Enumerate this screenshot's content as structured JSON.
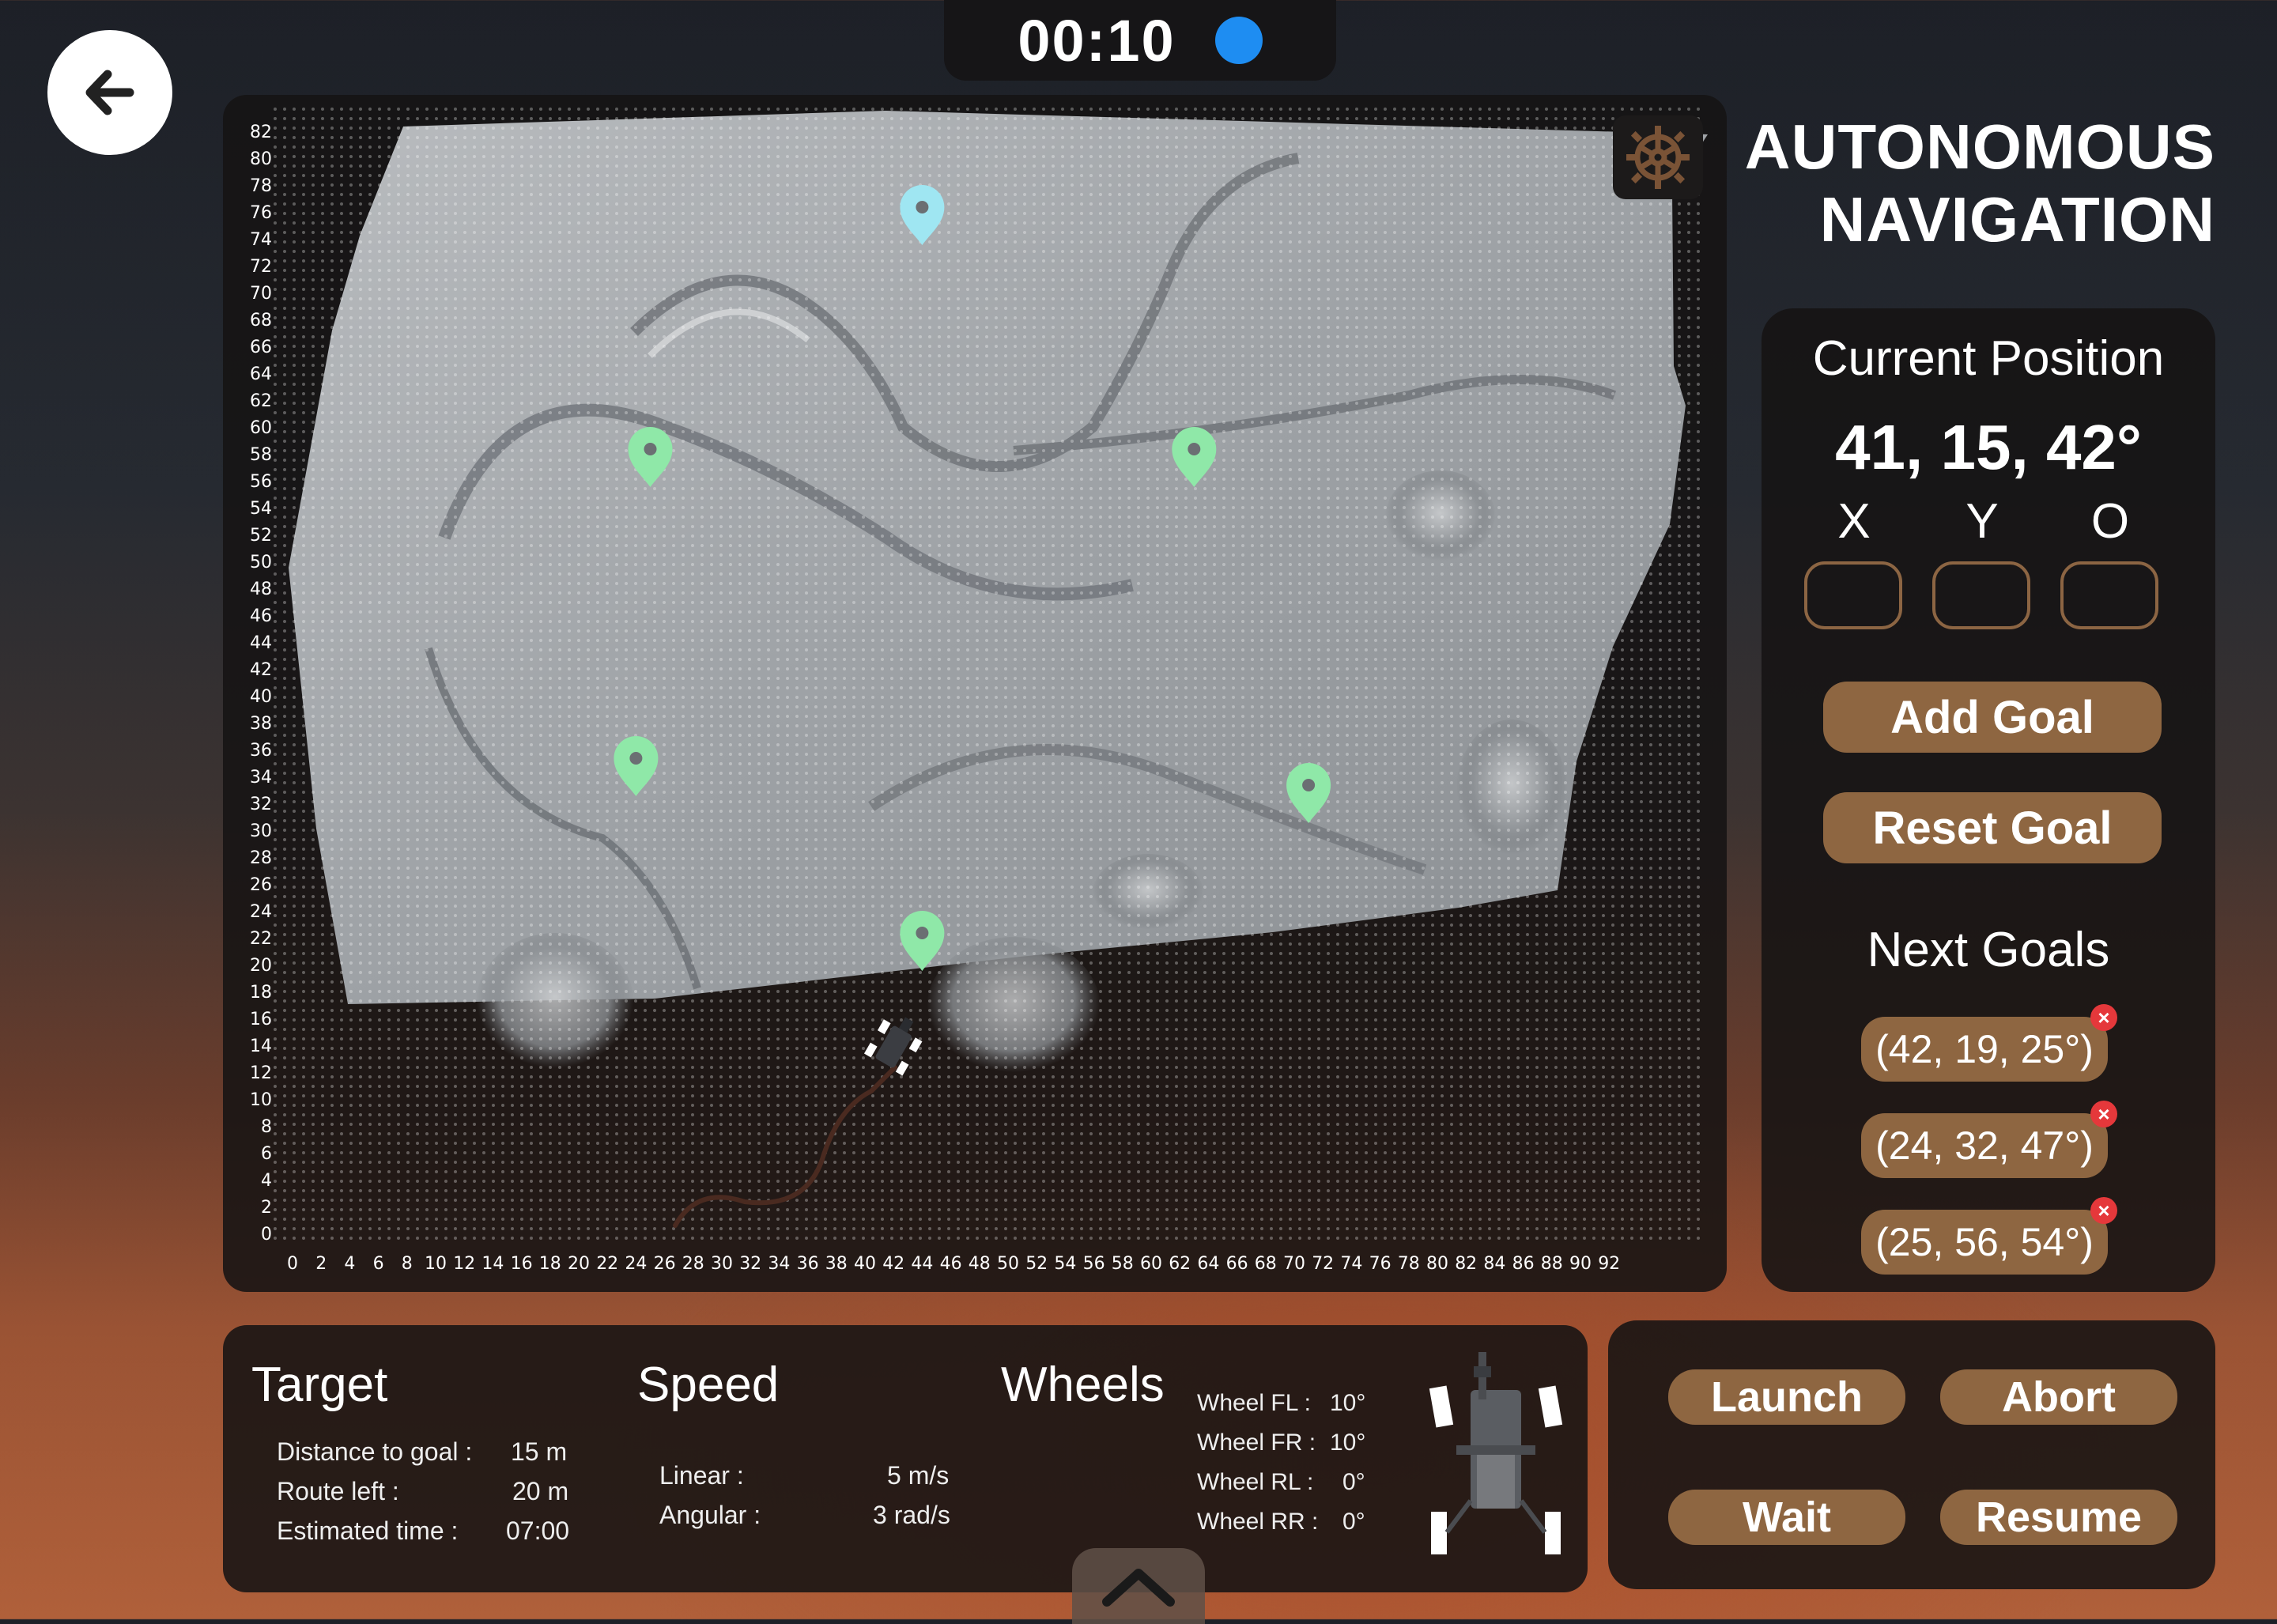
{
  "timer": {
    "time": "00:10",
    "status_color": "#1e8df2"
  },
  "title": {
    "line1": "AUTONOMOUS",
    "line2": "NAVIGATION"
  },
  "map": {
    "y_ticks": [
      "82",
      "80",
      "78",
      "76",
      "74",
      "72",
      "70",
      "68",
      "66",
      "64",
      "62",
      "60",
      "58",
      "56",
      "54",
      "52",
      "50",
      "48",
      "46",
      "44",
      "42",
      "40",
      "38",
      "36",
      "34",
      "32",
      "30",
      "28",
      "26",
      "24",
      "22",
      "20",
      "18",
      "16",
      "14",
      "12",
      "10",
      "8",
      "6",
      "4",
      "2",
      "0"
    ],
    "x_ticks": [
      "0",
      "2",
      "4",
      "6",
      "8",
      "10",
      "12",
      "14",
      "16",
      "18",
      "20",
      "22",
      "24",
      "26",
      "28",
      "30",
      "32",
      "34",
      "36",
      "38",
      "40",
      "42",
      "44",
      "46",
      "48",
      "50",
      "52",
      "54",
      "56",
      "58",
      "60",
      "62",
      "64",
      "66",
      "68",
      "70",
      "72",
      "74",
      "76",
      "78",
      "80",
      "82",
      "84",
      "86",
      "88",
      "90",
      "92"
    ],
    "goal_marker_color": "#8fe8a8",
    "start_marker_color": "#9fe6f2",
    "goal_markers": [
      {
        "x": 44,
        "y": 76,
        "kind": "start"
      },
      {
        "x": 25,
        "y": 58,
        "kind": "goal"
      },
      {
        "x": 63,
        "y": 58,
        "kind": "goal"
      },
      {
        "x": 24,
        "y": 35,
        "kind": "goal"
      },
      {
        "x": 71,
        "y": 33,
        "kind": "goal"
      },
      {
        "x": 44,
        "y": 22,
        "kind": "goal"
      }
    ],
    "rover": {
      "x": 42,
      "y": 14
    }
  },
  "current_position": {
    "heading": "Current Position",
    "value": "41, 15, 42°",
    "axis_x": "X",
    "axis_y": "Y",
    "axis_o": "O",
    "input_x": "",
    "input_y": "",
    "input_o": ""
  },
  "buttons": {
    "add_goal": "Add Goal",
    "reset_goal": "Reset Goal"
  },
  "next_goals": {
    "heading": "Next Goals",
    "items": [
      "(42, 19, 25°)",
      "(24, 32, 47°)",
      "(25, 56, 54°)"
    ],
    "remove_icon": "×"
  },
  "telemetry": {
    "target": {
      "heading": "Target",
      "distance_label": "Distance to goal :",
      "distance_value": "15 m",
      "route_label": "Route left :",
      "route_value": "20 m",
      "time_label": "Estimated time :",
      "time_value": "07:00"
    },
    "speed": {
      "heading": "Speed",
      "linear_label": "Linear :",
      "linear_value": "5 m/s",
      "angular_label": "Angular :",
      "angular_value": "3 rad/s"
    },
    "wheels": {
      "heading": "Wheels",
      "fl_label": "Wheel FL :",
      "fl_value": "10°",
      "fr_label": "Wheel FR :",
      "fr_value": "10°",
      "rl_label": "Wheel RL :",
      "rl_value": "0°",
      "rr_label": "Wheel RR :",
      "rr_value": "0°"
    }
  },
  "controls": {
    "launch": "Launch",
    "abort": "Abort",
    "wait": "Wait",
    "resume": "Resume"
  },
  "icons": {
    "back": "arrow-left-icon",
    "settings": "gear-icon",
    "collapse": "chevron-up-icon",
    "marker": "map-pin-icon",
    "rover": "rover-icon"
  },
  "colors": {
    "accent_brown": "#8e6641",
    "panel": "#161313",
    "recording": "#1e8df2",
    "remove": "#e5383b"
  }
}
